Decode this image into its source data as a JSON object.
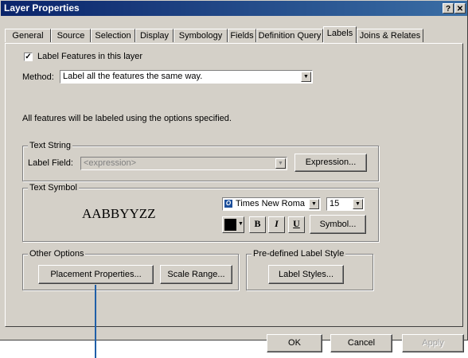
{
  "window": {
    "title": "Layer Properties",
    "help_button": "?",
    "close_button": "✕"
  },
  "tabs": [
    "General",
    "Source",
    "Selection",
    "Display",
    "Symbology",
    "Fields",
    "Definition Query",
    "Labels",
    "Joins & Relates"
  ],
  "active_tab": "Labels",
  "label_features": {
    "label": "Label Features in this layer",
    "checked": true
  },
  "method": {
    "label": "Method:",
    "value": "Label all the features the same way."
  },
  "info_text": "All features will be labeled using the options specified.",
  "text_string": {
    "title": "Text String",
    "field_label": "Label Field:",
    "field_value": "<expression>",
    "expression_button": "Expression..."
  },
  "text_symbol": {
    "title": "Text Symbol",
    "preview": "AABBYYZZ",
    "font": "Times New Roma",
    "font_icon": "O",
    "size": "15",
    "color_hex": "#000000",
    "bold": "B",
    "italic": "I",
    "underline": "U",
    "symbol_button": "Symbol..."
  },
  "other_options": {
    "title": "Other Options",
    "placement_button": "Placement Properties...",
    "scale_button": "Scale Range..."
  },
  "predefined_style": {
    "title": "Pre-defined Label Style",
    "label_styles_button": "Label Styles..."
  },
  "footer": {
    "ok": "OK",
    "cancel": "Cancel",
    "apply": "Apply"
  },
  "colors": {
    "pointer_line": "#1f5fa8",
    "title_bar": "#0a246a"
  }
}
